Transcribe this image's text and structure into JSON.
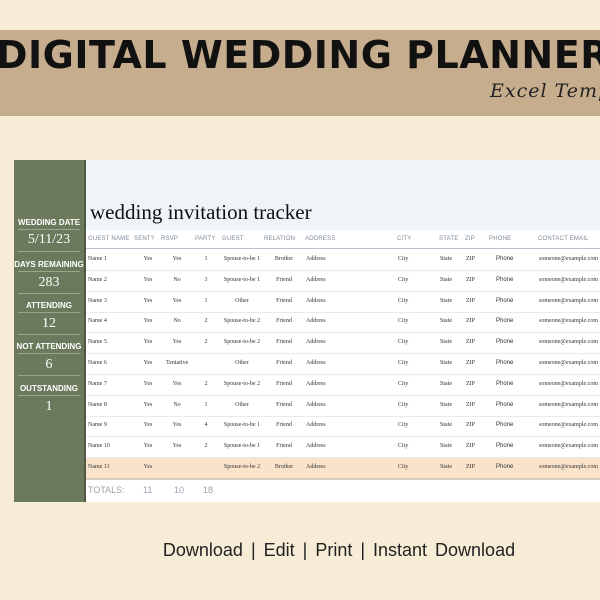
{
  "banner": {
    "title": "DIGITAL WEDDING PLANNER",
    "subtitle": "Excel Temp"
  },
  "sidebar": {
    "stats": [
      {
        "label": "WEDDING DATE",
        "value": "5/11/23"
      },
      {
        "label": "DAYS REMAINING",
        "value": "283"
      },
      {
        "label": "ATTENDING",
        "value": "12"
      },
      {
        "label": "NOT ATTENDING",
        "value": "6"
      },
      {
        "label": "OUTSTANDING",
        "value": "1"
      }
    ]
  },
  "tracker": {
    "title": "wedding invitation tracker",
    "columns": [
      "GUEST NAME",
      "SENT?",
      "RSVP",
      "PARTY",
      "GUEST",
      "RELATION",
      "ADDRESS",
      "CITY",
      "STATE",
      "ZIP",
      "PHONE",
      "CONTACT EMAIL"
    ],
    "rows": [
      [
        "Name 1",
        "Yes",
        "Yes",
        "1",
        "Spouse-to-be 1",
        "Brother",
        "Address",
        "City",
        "State",
        "ZIP",
        "Phone",
        "someone@example.com"
      ],
      [
        "Name 2",
        "Yes",
        "No",
        "3",
        "Spouse-to-be 1",
        "Friend",
        "Address",
        "City",
        "State",
        "ZIP",
        "Phone",
        "someone@example.com"
      ],
      [
        "Name 3",
        "Yes",
        "Yes",
        "1",
        "Other",
        "Friend",
        "Address",
        "City",
        "State",
        "ZIP",
        "Phone",
        "someone@example.com"
      ],
      [
        "Name 4",
        "Yes",
        "No",
        "2",
        "Spouse-to-be 2",
        "Friend",
        "Address",
        "City",
        "State",
        "ZIP",
        "Phone",
        "someone@example.com"
      ],
      [
        "Name 5",
        "Yes",
        "Yes",
        "2",
        "Spouse-to-be 2",
        "Friend",
        "Address",
        "City",
        "State",
        "ZIP",
        "Phone",
        "someone@example.com"
      ],
      [
        "Name 6",
        "Yes",
        "Tentative",
        "",
        "Other",
        "Friend",
        "Address",
        "City",
        "State",
        "ZIP",
        "Phone",
        "someone@example.com"
      ],
      [
        "Name 7",
        "Yes",
        "Yes",
        "2",
        "Spouse-to-be 2",
        "Friend",
        "Address",
        "City",
        "State",
        "ZIP",
        "Phone",
        "someone@example.com"
      ],
      [
        "Name 8",
        "Yes",
        "No",
        "1",
        "Other",
        "Friend",
        "Address",
        "City",
        "State",
        "ZIP",
        "Phone",
        "someone@example.com"
      ],
      [
        "Name 9",
        "Yes",
        "Yes",
        "4",
        "Spouse-to-be 1",
        "Friend",
        "Address",
        "City",
        "State",
        "ZIP",
        "Phone",
        "someone@example.com"
      ],
      [
        "Name 10",
        "Yes",
        "Yes",
        "2",
        "Spouse-to-be 1",
        "Friend",
        "Address",
        "City",
        "State",
        "ZIP",
        "Phone",
        "someone@example.com"
      ],
      [
        "Name 11",
        "Yes",
        "",
        "",
        "Spouse-to-be 2",
        "Brother",
        "Address",
        "City",
        "State",
        "ZIP",
        "Phone",
        "someone@example.com"
      ]
    ],
    "highlight_row": 10,
    "totals": {
      "label": "TOTALS:",
      "sent": "11",
      "rsvp": "10",
      "party": "18"
    }
  },
  "footer": {
    "text": "Download  |  Edit  |  Print  |  Instant  Download"
  },
  "colors": {
    "background": "#f7ecd5",
    "banner": "#c6ad8e",
    "sidebar": "#6b7a5c",
    "highlight_row": "#fae3cb"
  }
}
